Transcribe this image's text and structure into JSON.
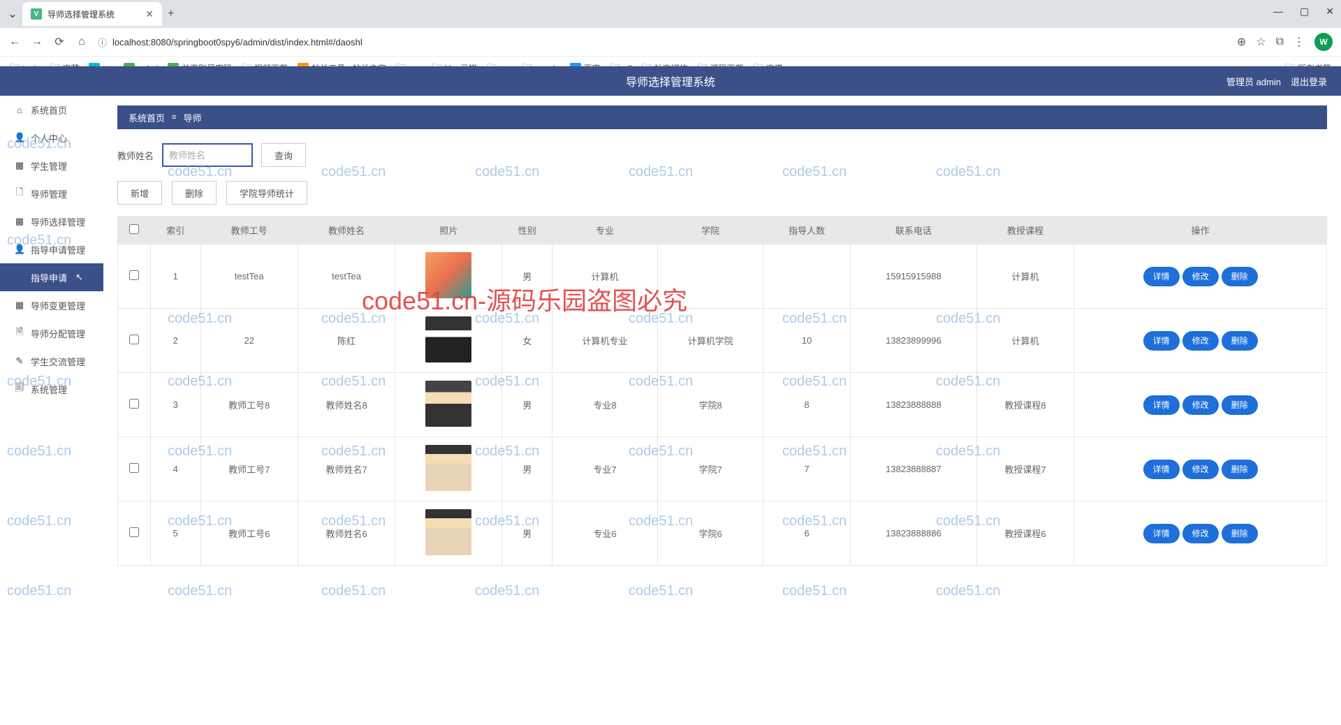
{
  "browser": {
    "tab_title": "导师选择管理系统",
    "url": "localhost:8080/springboot0spy6/admin/dist/index.html#/daoshl",
    "bookmarks": [
      {
        "label": "tools",
        "type": "folder"
      },
      {
        "label": "宝藏",
        "type": "folder"
      },
      {
        "label": "txy",
        "type": "fav",
        "color": "#00bcd4"
      },
      {
        "label": "uplod",
        "type": "fav",
        "color": "#4caf50"
      },
      {
        "label": "共享账号密码",
        "type": "fav",
        "color": "#4caf50"
      },
      {
        "label": "视频下载",
        "type": "folder"
      },
      {
        "label": "站长工具 - 站长之家",
        "type": "fav",
        "color": "#ff9800"
      },
      {
        "label": "vpn",
        "type": "folder"
      },
      {
        "label": "Max云梯",
        "type": "folder"
      },
      {
        "label": "vps",
        "type": "folder"
      },
      {
        "label": "google",
        "type": "folder"
      },
      {
        "label": "百度",
        "type": "fav",
        "color": "#2196f3"
      },
      {
        "label": "aff",
        "type": "folder"
      },
      {
        "label": "社交媒体",
        "type": "folder"
      },
      {
        "label": "源码下载",
        "type": "folder"
      },
      {
        "label": "宝塔",
        "type": "folder"
      }
    ],
    "bookmarks_right": "所有书签"
  },
  "header": {
    "title": "导师选择管理系统",
    "admin_label": "管理员 admin",
    "logout": "退出登录"
  },
  "sidebar": {
    "items": [
      {
        "label": "系统首页",
        "icon": "⌂"
      },
      {
        "label": "个人中心",
        "icon": "👤"
      },
      {
        "label": "学生管理",
        "icon": "▦"
      },
      {
        "label": "导师管理",
        "icon": "🗋"
      },
      {
        "label": "导师选择管理",
        "icon": "▦"
      },
      {
        "label": "指导申请管理",
        "icon": "👤"
      },
      {
        "label": "指导申请",
        "icon": "",
        "sub": true,
        "active": true
      },
      {
        "label": "导师变更管理",
        "icon": "▦"
      },
      {
        "label": "导师分配管理",
        "icon": "🗎"
      },
      {
        "label": "学生交流管理",
        "icon": "✎"
      },
      {
        "label": "系统管理",
        "icon": "🗐"
      }
    ]
  },
  "breadcrumb": {
    "home": "系统首页",
    "current": "导师"
  },
  "search": {
    "label": "教师姓名",
    "placeholder": "教师姓名",
    "btn": "查询"
  },
  "actions": {
    "add": "新增",
    "del": "删除",
    "stats": "学院导师统计"
  },
  "table": {
    "headers": [
      "",
      "索引",
      "教师工号",
      "教师姓名",
      "照片",
      "性别",
      "专业",
      "学院",
      "指导人数",
      "联系电话",
      "教授课程",
      "操作"
    ],
    "rows": [
      {
        "idx": "1",
        "tid": "testTea",
        "tname": "testTea",
        "gender": "男",
        "major": "计算机",
        "college": "",
        "count": "",
        "phone": "15915915988",
        "course": "计算机"
      },
      {
        "idx": "2",
        "tid": "22",
        "tname": "陈红",
        "gender": "女",
        "major": "计算机专业",
        "college": "计算机学院",
        "count": "10",
        "phone": "13823899996",
        "course": "计算机"
      },
      {
        "idx": "3",
        "tid": "教师工号8",
        "tname": "教师姓名8",
        "gender": "男",
        "major": "专业8",
        "college": "学院8",
        "count": "8",
        "phone": "13823888888",
        "course": "教授课程8"
      },
      {
        "idx": "4",
        "tid": "教师工号7",
        "tname": "教师姓名7",
        "gender": "男",
        "major": "专业7",
        "college": "学院7",
        "count": "7",
        "phone": "13823888887",
        "course": "教授课程7"
      },
      {
        "idx": "5",
        "tid": "教师工号6",
        "tname": "教师姓名6",
        "gender": "男",
        "major": "专业6",
        "college": "学院6",
        "count": "6",
        "phone": "13823888886",
        "course": "教授课程6"
      }
    ],
    "btns": {
      "detail": "详情",
      "edit": "修改",
      "del": "删除"
    }
  },
  "watermarks": {
    "text": "code51.cn",
    "big": "code51.cn-源码乐园盗图必究"
  }
}
